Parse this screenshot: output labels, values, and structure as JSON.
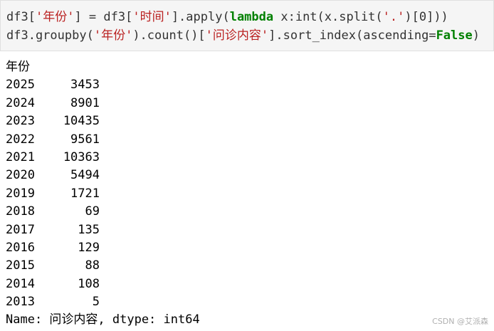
{
  "code": {
    "line1": {
      "prefix": "df3[",
      "str1": "'年份'",
      "mid": "] = df3[",
      "str2": "'时间'",
      "mid2": "].apply(",
      "kw": "lambda",
      "mid3": " x:int(x.split(",
      "str3": "'.'",
      "suffix": ")[0]))"
    },
    "line2": {
      "prefix": "df3.groupby(",
      "str1": "'年份'",
      "mid": ").count()[",
      "str2": "'问诊内容'",
      "mid2": "].sort_index(ascending=",
      "kw": "False",
      "suffix": ")"
    }
  },
  "output": {
    "header": "年份",
    "rows": [
      {
        "year": "2025",
        "count": "3453"
      },
      {
        "year": "2024",
        "count": "8901"
      },
      {
        "year": "2023",
        "count": "10435"
      },
      {
        "year": "2022",
        "count": "9561"
      },
      {
        "year": "2021",
        "count": "10363"
      },
      {
        "year": "2020",
        "count": "5494"
      },
      {
        "year": "2019",
        "count": "1721"
      },
      {
        "year": "2018",
        "count": "69"
      },
      {
        "year": "2017",
        "count": "135"
      },
      {
        "year": "2016",
        "count": "129"
      },
      {
        "year": "2015",
        "count": "88"
      },
      {
        "year": "2014",
        "count": "108"
      },
      {
        "year": "2013",
        "count": "5"
      }
    ],
    "footer": "Name: 问诊内容, dtype: int64"
  },
  "watermark": "CSDN @艾派森",
  "colors": {
    "string": "#ba2121",
    "keyword": "#008000",
    "cell_background": "#f5f5f5"
  }
}
